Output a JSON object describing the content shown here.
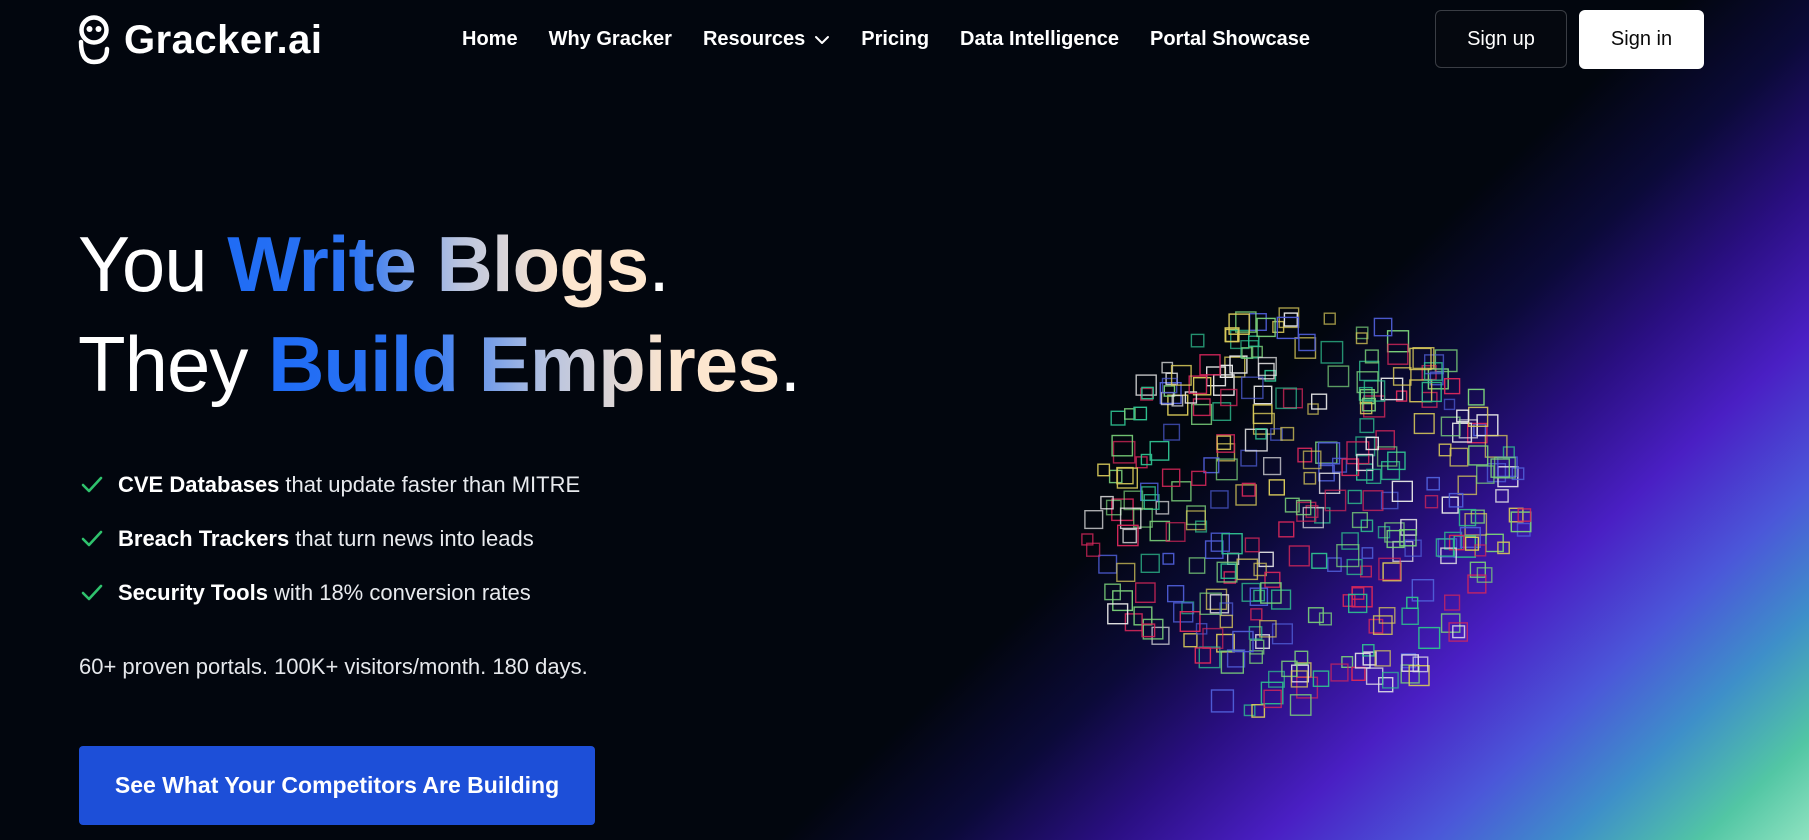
{
  "brand": {
    "name": "Gracker.ai",
    "logo_icon": "smiley-face-logo-icon"
  },
  "nav": {
    "links": [
      "Home",
      "Why Gracker",
      "Resources",
      "Pricing",
      "Data Intelligence",
      "Portal Showcase"
    ],
    "resources_icon": "chevron-down-icon",
    "sign_up": "Sign up",
    "sign_in": "Sign in"
  },
  "hero": {
    "line1": {
      "plain": "You ",
      "highlight": "Write Blogs",
      "end": "."
    },
    "line2": {
      "plain": "They ",
      "highlight": "Build Empires",
      "end": "."
    },
    "features": [
      {
        "bold": "CVE Databases",
        "rest": "that update faster than MITRE"
      },
      {
        "bold": "Breach Trackers",
        "rest": "that turn news into leads"
      },
      {
        "bold": "Security Tools",
        "rest": "with 18% conversion rates"
      }
    ],
    "feature_icon": "check-icon",
    "stats": "60+ proven portals. 100K+ visitors/month. 180 days.",
    "cta": "See What Your Competitors Are Building"
  },
  "colors": {
    "background": "#02060e",
    "cta": "#1d4fd8",
    "check": "#2fc26d",
    "squares": [
      "#2fbf8f",
      "#d8c95a",
      "#d6275a",
      "#4f5ed8",
      "#7ad07a",
      "#e6e6e6"
    ]
  },
  "visual": {
    "type": "sphere-of-outlined-squares",
    "icon": "particle-sphere-graphic"
  }
}
